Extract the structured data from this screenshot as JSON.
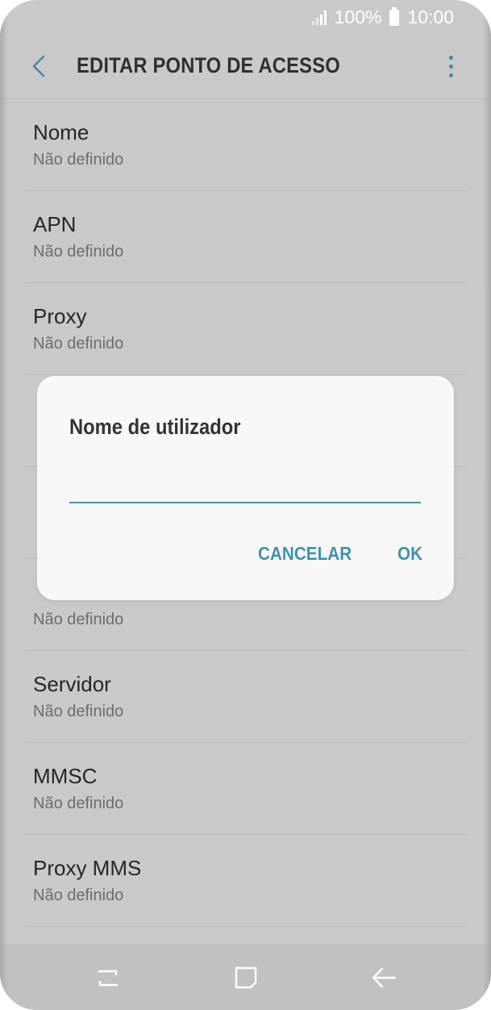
{
  "status_bar": {
    "battery": "100%",
    "time": "10:00"
  },
  "app_bar": {
    "title": "EDITAR PONTO DE ACESSO"
  },
  "list": {
    "items": [
      {
        "title": "Nome",
        "value": "Não definido"
      },
      {
        "title": "APN",
        "value": "Não definido"
      },
      {
        "title": "Proxy",
        "value": "Não definido"
      },
      {
        "title": "",
        "value": ""
      },
      {
        "title": "",
        "value": ""
      },
      {
        "title": "",
        "value": "Não definido"
      },
      {
        "title": "Servidor",
        "value": "Não definido"
      },
      {
        "title": "MMSC",
        "value": "Não definido"
      },
      {
        "title": "Proxy MMS",
        "value": "Não definido"
      }
    ]
  },
  "dialog": {
    "title": "Nome de utilizador",
    "input_value": "",
    "cancel_label": "CANCELAR",
    "ok_label": "OK"
  },
  "colors": {
    "accent": "#3d93b0",
    "background": "#c9c9c9",
    "dialog": "#f8f8f8"
  },
  "icons": {
    "back": "chevron-left-icon",
    "menu": "more-vertical-icon",
    "recent": "recent-apps-icon",
    "home": "home-icon",
    "nav_back": "back-arrow-icon"
  }
}
